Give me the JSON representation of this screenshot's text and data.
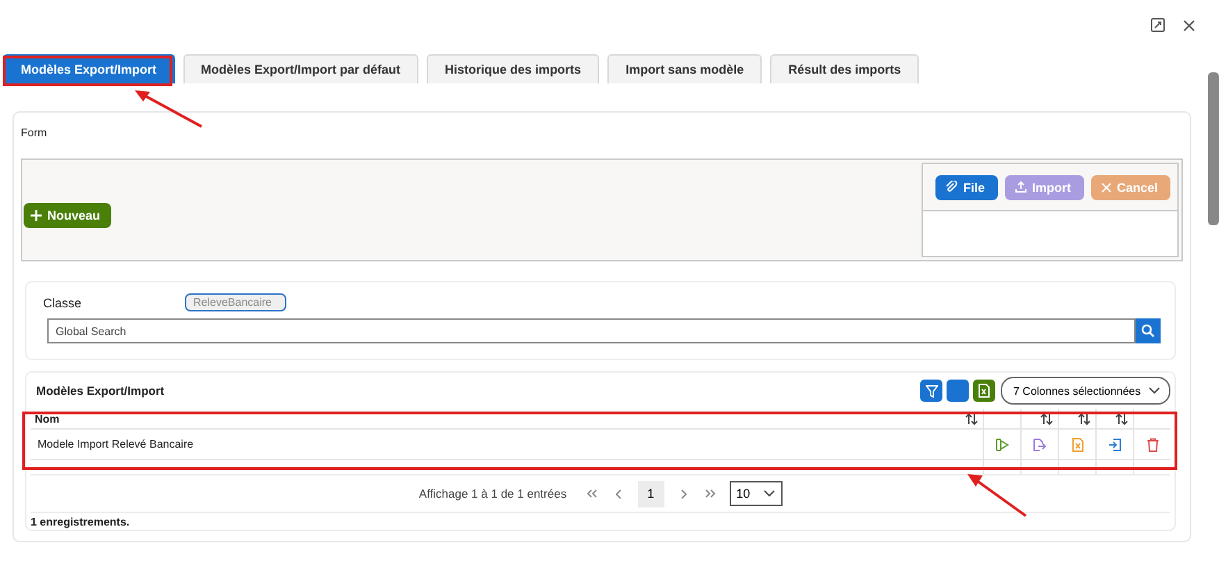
{
  "tabs": [
    {
      "label": "Modèles Export/Import",
      "selected": true
    },
    {
      "label": "Modèles Export/Import par défaut",
      "selected": false
    },
    {
      "label": "Historique des imports",
      "selected": false
    },
    {
      "label": "Import sans modèle",
      "selected": false
    },
    {
      "label": "Résult des imports",
      "selected": false
    }
  ],
  "form": {
    "label": "Form",
    "new_button": "Nouveau",
    "upload_buttons": [
      {
        "kind": "file",
        "label": "File",
        "disabled": false
      },
      {
        "kind": "import",
        "label": "Import",
        "disabled": true
      },
      {
        "kind": "cancel",
        "label": "Cancel",
        "disabled": true
      }
    ]
  },
  "filter": {
    "class_label": "Classe",
    "class_value": "ReleveBancaire",
    "search_placeholder": "Global Search"
  },
  "table": {
    "title": "Modèles Export/Import",
    "columns_button": "7 Colonnes sélectionnées",
    "columns": [
      {
        "label": "Nom",
        "sortable": true
      },
      {
        "sortable": false
      },
      {
        "sortable": true
      },
      {
        "sortable": true
      },
      {
        "sortable": true
      },
      {
        "sortable": false
      }
    ],
    "rows": [
      {
        "name": "Modele Import Relevé Bancaire",
        "actions": [
          {
            "kind": "run"
          },
          {
            "kind": "edit"
          },
          {
            "kind": "export"
          },
          {
            "kind": "import"
          },
          {
            "kind": "delete"
          }
        ]
      }
    ],
    "pagination": {
      "info": "Affichage 1 à 1 de 1 entrées",
      "pages": [
        {
          "label": "1",
          "selected": true
        }
      ],
      "page_size": "10"
    },
    "footer": "1 enregistrements."
  }
}
